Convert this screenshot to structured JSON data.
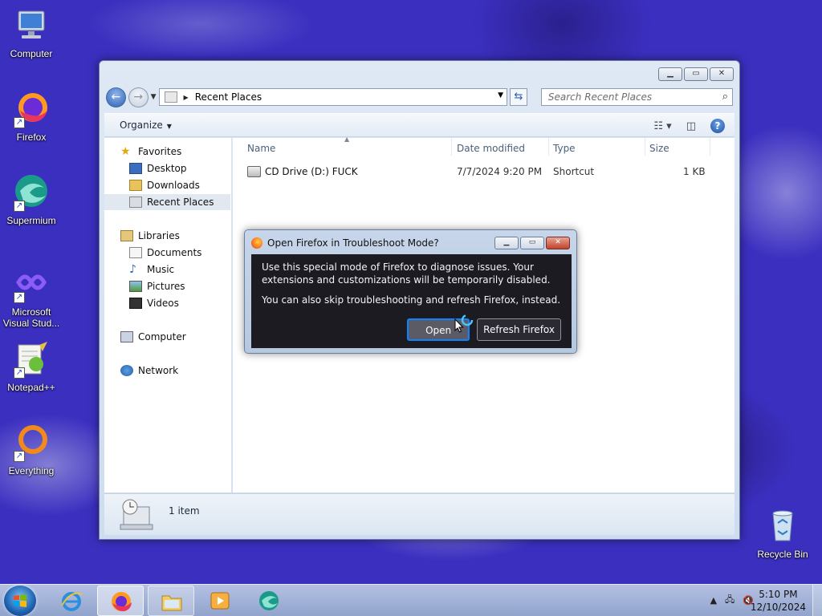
{
  "desktop": {
    "icons": [
      {
        "label": "Computer",
        "icon": "computer-icon"
      },
      {
        "label": "Firefox",
        "icon": "firefox-icon"
      },
      {
        "label": "Supermium",
        "icon": "supermium-icon"
      },
      {
        "label": "Microsoft Visual Stud...",
        "icon": "visual-studio-icon"
      },
      {
        "label": "Notepad++",
        "icon": "notepadpp-icon"
      },
      {
        "label": "Everything",
        "icon": "everything-icon"
      },
      {
        "label": "Recycle Bin",
        "icon": "recycle-bin-icon"
      }
    ]
  },
  "explorer": {
    "address": "Recent Places",
    "search_placeholder": "Search Recent Places",
    "toolbar": {
      "organize": "Organize"
    },
    "nav": {
      "favorites": "Favorites",
      "favorites_items": [
        "Desktop",
        "Downloads",
        "Recent Places"
      ],
      "libraries": "Libraries",
      "libraries_items": [
        "Documents",
        "Music",
        "Pictures",
        "Videos"
      ],
      "computer": "Computer",
      "network": "Network"
    },
    "columns": [
      "Name",
      "Date modified",
      "Type",
      "Size"
    ],
    "rows": [
      {
        "name": "CD Drive (D:) FUCK",
        "date": "7/7/2024 9:20 PM",
        "type": "Shortcut",
        "size": "1 KB"
      }
    ],
    "status": "1 item"
  },
  "dialog": {
    "title": "Open Firefox in Troubleshoot Mode?",
    "message1": "Use this special mode of Firefox to diagnose issues. Your extensions and customizations will be temporarily disabled.",
    "message2": "You can also skip troubleshooting and refresh Firefox, instead.",
    "open_label": "Open",
    "refresh_label": "Refresh Firefox"
  },
  "taskbar": {
    "time": "5:10 PM",
    "date": "12/10/2024"
  },
  "colors": {
    "desktop_bg": "#3b2fc0",
    "dialog_bg": "#1c1b22",
    "focus_ring": "#0a84ff",
    "close_red": "#c2412c"
  }
}
